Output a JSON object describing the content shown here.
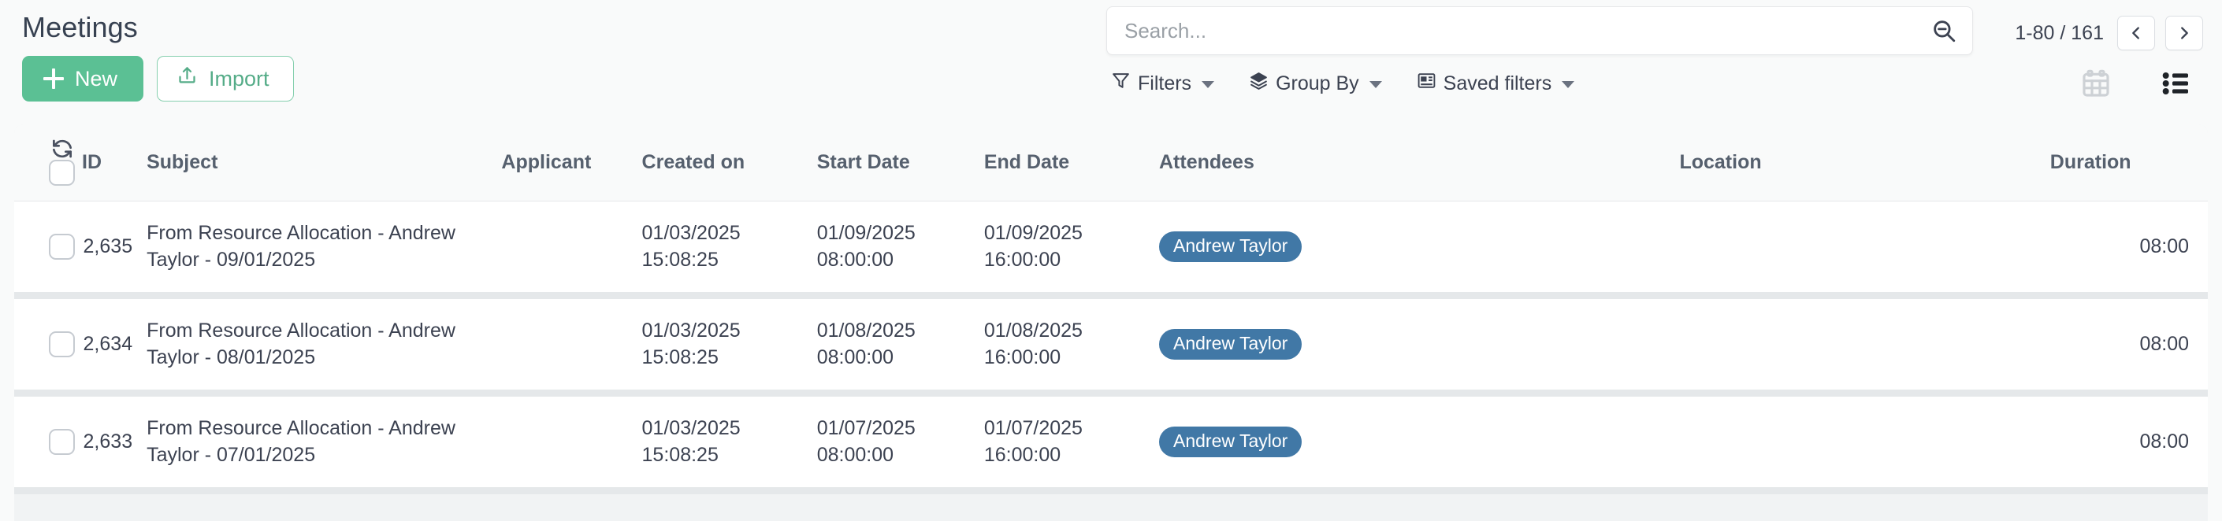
{
  "header": {
    "title": "Meetings",
    "new_label": "New",
    "import_label": "Import",
    "import_icon": "upload-icon",
    "new_icon": "plus-icon"
  },
  "search": {
    "placeholder": "Search...",
    "value": "",
    "icon": "magnifier-minus-icon"
  },
  "filter_menus": [
    {
      "label": "Filters",
      "icon": "funnel-icon",
      "caret": "chevron-down-icon"
    },
    {
      "label": "Group By",
      "icon": "layers-icon",
      "caret": "chevron-down-icon"
    },
    {
      "label": "Saved filters",
      "icon": "saved-filters-icon",
      "caret": "chevron-down-icon"
    }
  ],
  "pager": {
    "count": "1-80 / 161",
    "prev_label": "‹",
    "next_label": "›"
  },
  "view_switcher": [
    {
      "name": "calendar",
      "icon": "calendar-icon",
      "active": false
    },
    {
      "name": "list",
      "icon": "list-icon",
      "active": true
    }
  ],
  "table": {
    "columns": [
      "ID",
      "Subject",
      "Applicant",
      "Created on",
      "Start Date",
      "End Date",
      "Attendees",
      "Location",
      "Duration"
    ],
    "refresh_icon": "refresh-icon",
    "rows": [
      {
        "id": "2,635",
        "subject_line1": "From Resource Allocation - Andrew",
        "subject_line2": "Taylor - 09/01/2025",
        "applicant": "",
        "created_date": "01/03/2025",
        "created_time": "15:08:25",
        "start_date": "01/09/2025",
        "start_time": "08:00:00",
        "end_date": "01/09/2025",
        "end_time": "16:00:00",
        "attendee": "Andrew Taylor",
        "location": "",
        "duration": "08:00"
      },
      {
        "id": "2,634",
        "subject_line1": "From Resource Allocation - Andrew",
        "subject_line2": "Taylor - 08/01/2025",
        "applicant": "",
        "created_date": "01/03/2025",
        "created_time": "15:08:25",
        "start_date": "01/08/2025",
        "start_time": "08:00:00",
        "end_date": "01/08/2025",
        "end_time": "16:00:00",
        "attendee": "Andrew Taylor",
        "location": "",
        "duration": "08:00"
      },
      {
        "id": "2,633",
        "subject_line1": "From Resource Allocation - Andrew",
        "subject_line2": "Taylor - 07/01/2025",
        "applicant": "",
        "created_date": "01/03/2025",
        "created_time": "15:08:25",
        "start_date": "01/07/2025",
        "start_time": "08:00:00",
        "end_date": "01/07/2025",
        "end_time": "16:00:00",
        "attendee": "Andrew Taylor",
        "location": "",
        "duration": "08:00"
      }
    ]
  },
  "colors": {
    "accent_green": "#5bc094",
    "badge_blue": "#4178a6",
    "page_bg": "#f9fafa",
    "row_divider": "#e5e8ea"
  }
}
